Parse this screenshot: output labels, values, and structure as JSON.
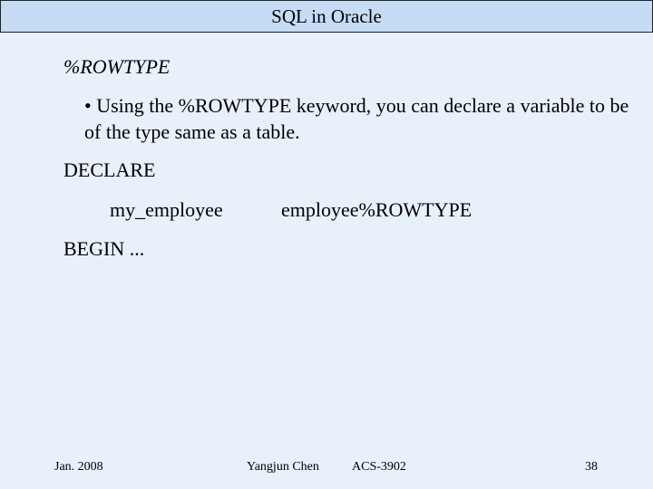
{
  "slide": {
    "title": "SQL in Oracle",
    "section_heading": "%ROWTYPE",
    "bullet": "• Using the %ROWTYPE keyword, you can declare a variable to be of the type same as a table.",
    "code": {
      "declare": "DECLARE",
      "var_name": "my_employee",
      "var_type": "employee%ROWTYPE",
      "begin": "BEGIN ..."
    },
    "footer": {
      "date": "Jan. 2008",
      "author": "Yangjun Chen",
      "course": "ACS-3902",
      "page": "38"
    }
  }
}
